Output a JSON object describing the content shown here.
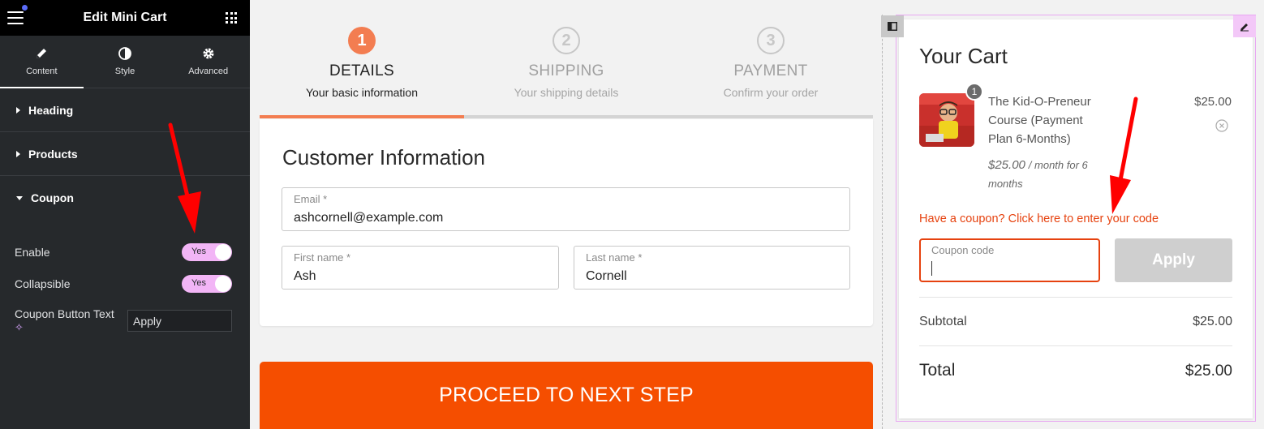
{
  "editor": {
    "title": "Edit Mini Cart",
    "tabs": [
      {
        "label": "Content",
        "icon": "pencil-icon"
      },
      {
        "label": "Style",
        "icon": "contrast-icon"
      },
      {
        "label": "Advanced",
        "icon": "gear-icon"
      }
    ],
    "sections": [
      {
        "label": "Heading"
      },
      {
        "label": "Products"
      },
      {
        "label": "Coupon"
      }
    ],
    "controls": {
      "enable_label": "Enable",
      "enable_value": "Yes",
      "collapsible_label": "Collapsible",
      "collapsible_value": "Yes",
      "button_text_label": "Coupon Button Text",
      "button_text_value": "Apply"
    }
  },
  "checkout": {
    "steps": [
      {
        "num": "1",
        "title": "DETAILS",
        "sub": "Your basic information"
      },
      {
        "num": "2",
        "title": "SHIPPING",
        "sub": "Your shipping details"
      },
      {
        "num": "3",
        "title": "PAYMENT",
        "sub": "Confirm your order"
      }
    ],
    "progress": 0.333,
    "customer_title": "Customer Information",
    "fields": {
      "email_label": "Email *",
      "email_value": "ashcornell@example.com",
      "first_label": "First name *",
      "first_value": "Ash",
      "last_label": "Last name *",
      "last_value": "Cornell"
    },
    "proceed_label": "PROCEED TO NEXT STEP"
  },
  "cart": {
    "title": "Your Cart",
    "item": {
      "qty": "1",
      "name": "The Kid-O-Preneur Course (Payment Plan 6-Months)",
      "price": "$25.00",
      "sub_price": "$25.00",
      "sub_suffix": "/ month for 6 months"
    },
    "coupon_link": "Have a coupon? Click here to enter your code",
    "coupon_placeholder": "Coupon code",
    "apply_label": "Apply",
    "subtotal_label": "Subtotal",
    "subtotal_value": "$25.00",
    "total_label": "Total",
    "total_value": "$25.00"
  },
  "colors": {
    "accent": "#f37d51",
    "cta": "#f54e00",
    "link": "#e6420f",
    "toggle": "#f2b5f6",
    "annotation": "#ff0000"
  }
}
